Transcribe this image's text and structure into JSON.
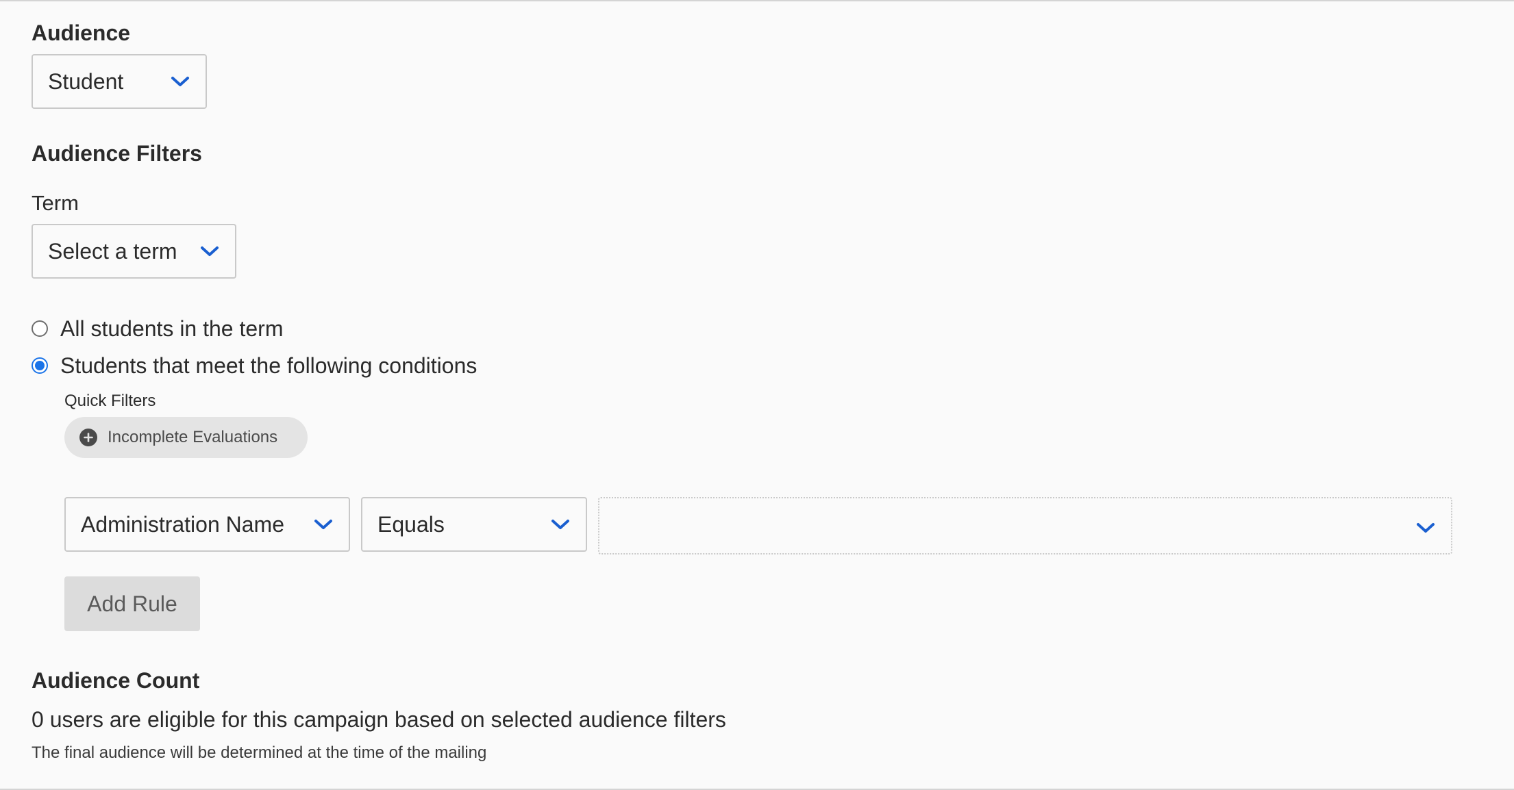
{
  "audience": {
    "heading": "Audience",
    "selected": "Student"
  },
  "filters": {
    "heading": "Audience Filters",
    "term_label": "Term",
    "term_selected": "Select a term",
    "radio_all": "All students in the term",
    "radio_conditions": "Students that meet the following conditions",
    "radio_selected": "conditions"
  },
  "quick_filters": {
    "label": "Quick Filters",
    "chips": [
      "Incomplete Evaluations"
    ]
  },
  "rule": {
    "field": "Administration Name",
    "operator": "Equals",
    "value": ""
  },
  "add_rule_label": "Add Rule",
  "count": {
    "heading": "Audience Count",
    "summary": "0 users are eligible for this campaign based on selected audience filters",
    "note": "The final audience will be determined at the time of the mailing"
  },
  "colors": {
    "accent": "#1a73e8",
    "chip_bg": "#e4e4e4",
    "button_bg": "#dcdcdc"
  }
}
